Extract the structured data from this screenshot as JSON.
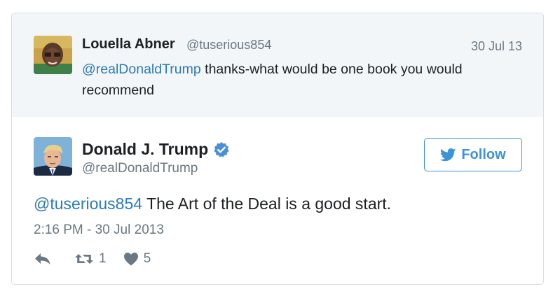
{
  "parent_tweet": {
    "author_name": "Louella Abner",
    "author_handle": "@tuserious854",
    "date": "30 Jul 13",
    "mention": "@realDonaldTrump",
    "text": " thanks-what would be one book you would recommend"
  },
  "main_tweet": {
    "author_name": "Donald J. Trump",
    "author_handle": "@realDonaldTrump",
    "verified": true,
    "follow_label": "Follow",
    "mention": "@tuserious854",
    "text": " The Art of the Deal is a good start.",
    "timestamp": "2:16 PM - 30 Jul 2013",
    "retweet_count": "1",
    "like_count": "5"
  },
  "icons": {
    "reply": "reply-icon",
    "retweet": "retweet-icon",
    "like": "heart-icon",
    "verified": "verified-badge-icon",
    "follow": "twitter-bird-icon"
  },
  "colors": {
    "link": "#2b7bb9",
    "follow_accent": "#3b94d9",
    "verified": "#4a90d6",
    "muted": "#697882",
    "parent_background": "#f3f6f8"
  }
}
